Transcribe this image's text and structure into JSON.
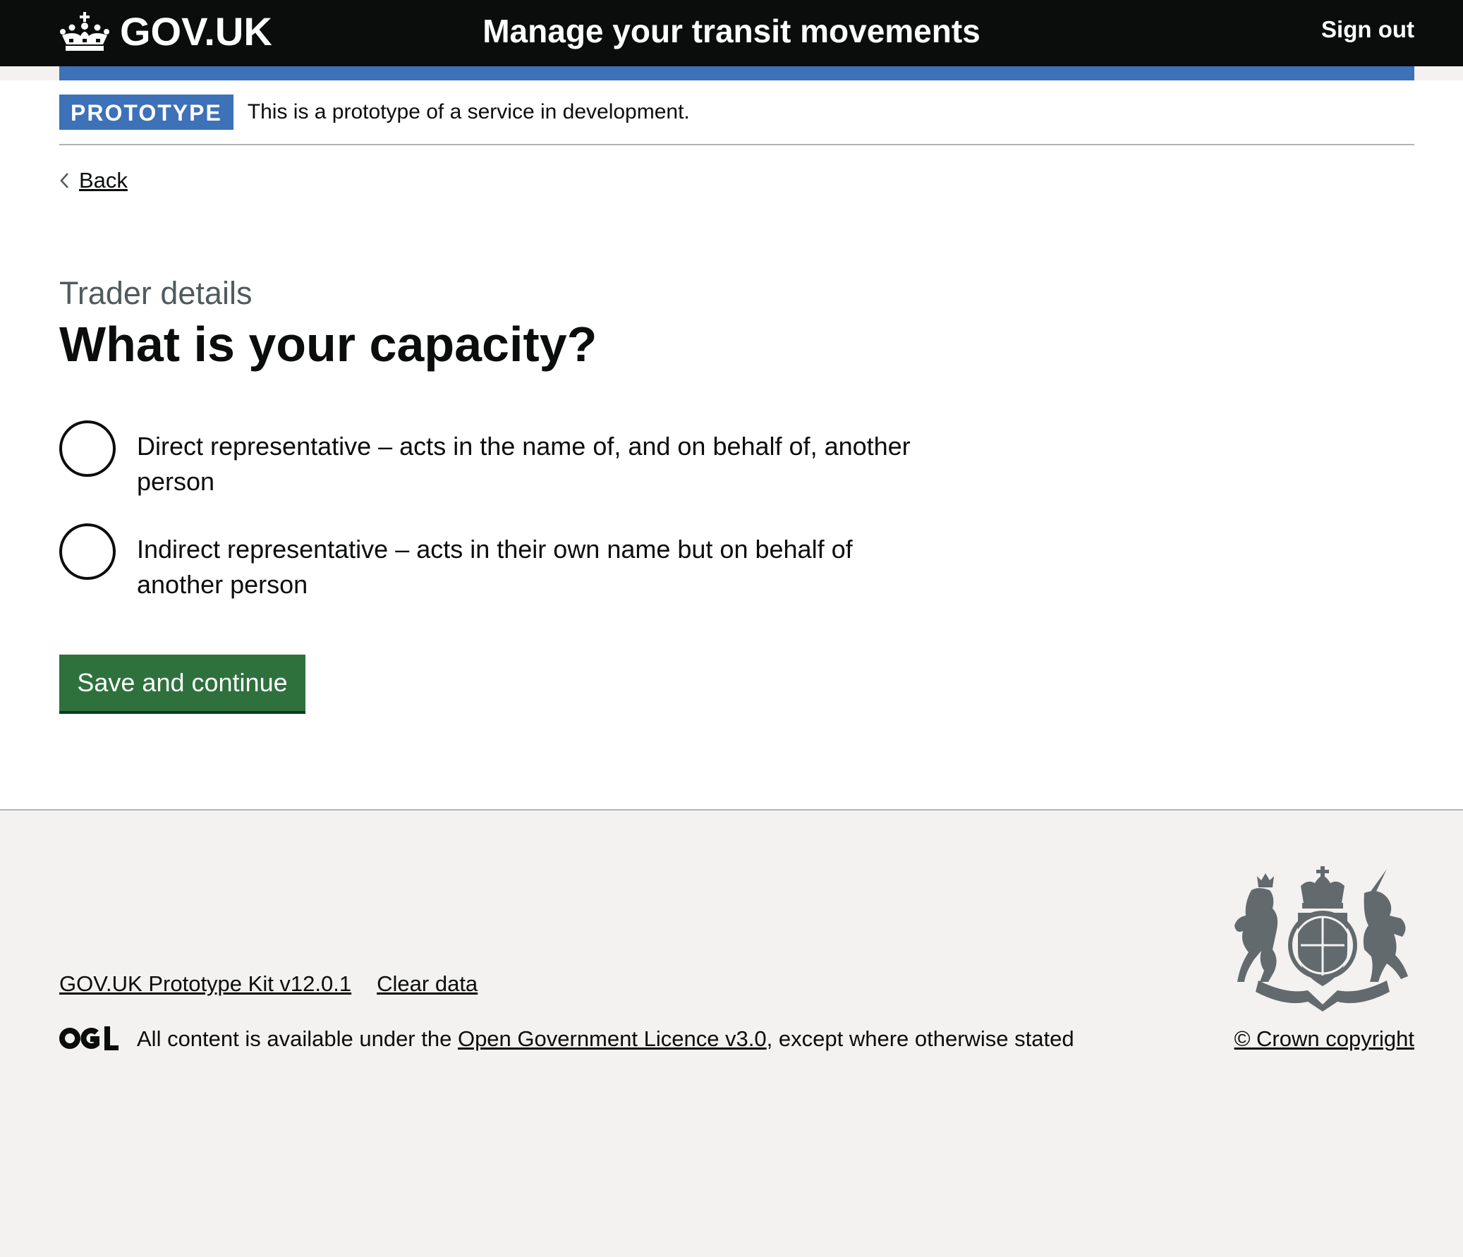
{
  "header": {
    "logo_text": "GOV.UK",
    "service_name": "Manage your transit movements",
    "sign_out_label": "Sign out"
  },
  "phase_banner": {
    "tag": "PROTOTYPE",
    "text": "This is a prototype of a service in development."
  },
  "back_link": {
    "label": "Back"
  },
  "form": {
    "caption": "Trader details",
    "heading": "What is your capacity?",
    "options": [
      {
        "label": "Direct representative – acts in the name of, and on behalf of, another person",
        "checked": false
      },
      {
        "label": "Indirect representative – acts in their own name but on behalf of another person",
        "checked": false
      }
    ],
    "submit_label": "Save and continue"
  },
  "footer": {
    "links": [
      {
        "label": "GOV.UK Prototype Kit v12.0.1"
      },
      {
        "label": "Clear data"
      }
    ],
    "licence_prefix": "All content is available under the ",
    "licence_link": "Open Government Licence v3.0",
    "licence_suffix": ", except where otherwise stated",
    "copyright": "© Crown copyright"
  },
  "colors": {
    "header_background": "#0b0c0c",
    "accent_blue": "#3d71b8",
    "button_green": "#2e713d",
    "footer_background": "#f3f2f1",
    "caption_grey": "#505a5f"
  },
  "icons": {
    "logo": "crown-icon",
    "back": "chevron-left-icon",
    "licence": "ogl-logo-icon",
    "crest": "royal-coat-of-arms-icon"
  }
}
